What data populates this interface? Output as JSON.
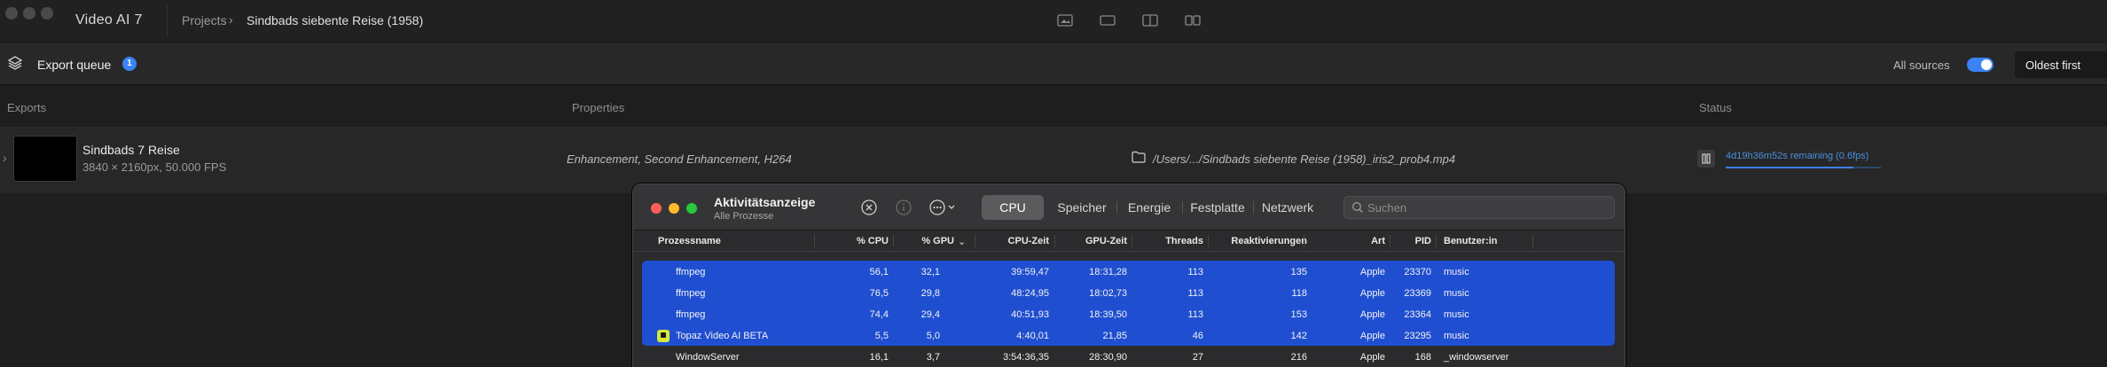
{
  "titlebar": {
    "app_title": "Video AI 7",
    "breadcrumb_projects": "Projects",
    "breadcrumb_current": "Sindbads siebente Reise (1958)"
  },
  "queue": {
    "label": "Export queue",
    "count": "1",
    "sources_label": "All sources",
    "sources_toggle_on": true,
    "sort_value": "Oldest first"
  },
  "columns": {
    "exports": "Exports",
    "properties": "Properties",
    "status": "Status"
  },
  "export_item": {
    "name": "Sindbads 7 Reise",
    "resolution": "3840 × 2160px, 50.000 FPS",
    "properties": "Enhancement, Second Enhancement, H264",
    "path": "/Users/.../Sindbads siebente Reise (1958)_iris2_prob4.mp4",
    "status": "4d19h36m52s remaining (0.6fps)",
    "progress": 0.82
  },
  "activity_monitor": {
    "title": "Aktivitätsanzeige",
    "subtitle": "Alle Prozesse",
    "tabs": [
      "CPU",
      "Speicher",
      "Energie",
      "Festplatte",
      "Netzwerk"
    ],
    "active_tab": "CPU",
    "search_placeholder": "Suchen",
    "headers": {
      "name": "Prozessname",
      "cpu": "% CPU",
      "gpu": "% GPU",
      "cpu_time": "CPU-Zeit",
      "gpu_time": "GPU-Zeit",
      "threads": "Threads",
      "wakeups": "Reaktivierungen",
      "kind": "Art",
      "pid": "PID",
      "user": "Benutzer:in"
    },
    "rows": [
      {
        "name": "ffmpeg",
        "cpu": "56,1",
        "gpu": "32,1",
        "cpu_time": "39:59,47",
        "gpu_time": "18:31,28",
        "threads": "113",
        "wakeups": "135",
        "kind": "Apple",
        "pid": "23370",
        "user": "music",
        "selected": true,
        "icon": ""
      },
      {
        "name": "ffmpeg",
        "cpu": "76,5",
        "gpu": "29,8",
        "cpu_time": "48:24,95",
        "gpu_time": "18:02,73",
        "threads": "113",
        "wakeups": "118",
        "kind": "Apple",
        "pid": "23369",
        "user": "music",
        "selected": true,
        "icon": ""
      },
      {
        "name": "ffmpeg",
        "cpu": "74,4",
        "gpu": "29,4",
        "cpu_time": "40:51,93",
        "gpu_time": "18:39,50",
        "threads": "113",
        "wakeups": "153",
        "kind": "Apple",
        "pid": "23364",
        "user": "music",
        "selected": true,
        "icon": ""
      },
      {
        "name": "Topaz Video AI BETA",
        "cpu": "5,5",
        "gpu": "5,0",
        "cpu_time": "4:40,01",
        "gpu_time": "21,85",
        "threads": "46",
        "wakeups": "142",
        "kind": "Apple",
        "pid": "23295",
        "user": "music",
        "selected": true,
        "icon": "topaz-app-icon"
      },
      {
        "name": "WindowServer",
        "cpu": "16,1",
        "gpu": "3,7",
        "cpu_time": "3:54:36,35",
        "gpu_time": "28:30,90",
        "threads": "27",
        "wakeups": "216",
        "kind": "Apple",
        "pid": "168",
        "user": "_windowserver",
        "selected": false,
        "icon": ""
      }
    ]
  },
  "colors": {
    "accent": "#3b82f6",
    "selection": "#1f4fd0",
    "status_text": "#4a8fe0"
  }
}
